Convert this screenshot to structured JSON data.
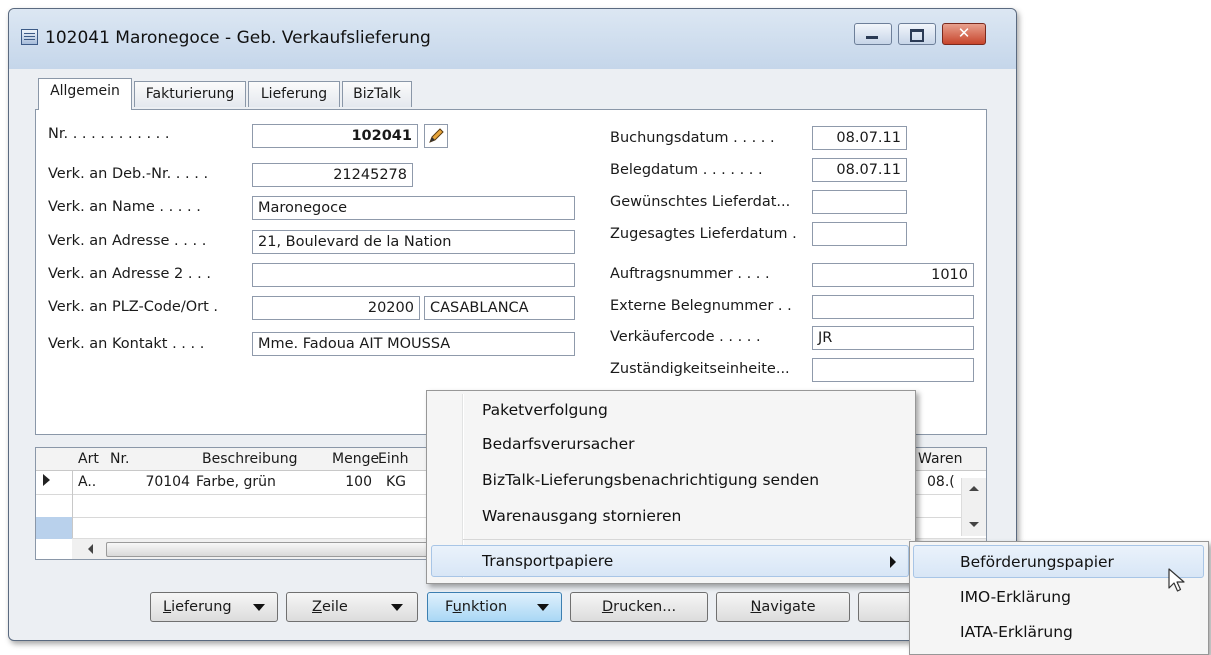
{
  "window": {
    "title": "102041 Maronegoce - Geb. Verkaufslieferung",
    "close_glyph": "✕"
  },
  "tabs": [
    "Allgemein",
    "Fakturierung",
    "Lieferung",
    "BizTalk"
  ],
  "left_fields": [
    {
      "label": "Nr. . . . . . . . . . . .",
      "value": "102041"
    },
    {
      "label": "Verk. an Deb.-Nr. . . . .",
      "value": "21245278"
    },
    {
      "label": "Verk. an Name . . . . .",
      "value": "Maronegoce"
    },
    {
      "label": "Verk. an Adresse . . . .",
      "value": "21, Boulevard de la Nation"
    },
    {
      "label": "Verk. an Adresse 2 . . .",
      "value": ""
    },
    {
      "label": "Verk. an PLZ-Code/Ort .",
      "value": "20200",
      "value2": "CASABLANCA"
    },
    {
      "label": "Verk. an Kontakt . . . .",
      "value": "Mme. Fadoua AIT MOUSSA"
    }
  ],
  "right_fields": [
    {
      "label": "Buchungsdatum . . . . .",
      "value": "08.07.11"
    },
    {
      "label": "Belegdatum . . . . . . .",
      "value": "08.07.11"
    },
    {
      "label": "Gewünschtes Lieferdat...",
      "value": ""
    },
    {
      "label": "Zugesagtes Lieferdatum .",
      "value": ""
    },
    {
      "label": "Auftragsnummer . . . .",
      "value": "1010"
    },
    {
      "label": "Externe Belegnummer . .",
      "value": ""
    },
    {
      "label": "Verkäufercode . . . . .",
      "value": "JR"
    },
    {
      "label": "Zuständigkeitseinheite...",
      "value": ""
    }
  ],
  "lines_table": {
    "headers": [
      "Art",
      "Nr.",
      "Beschreibung",
      "Menge",
      "Einh",
      "Waren"
    ],
    "row": {
      "art": "A..",
      "nr": "70104",
      "beschreibung": "Farbe, grün",
      "menge": "100",
      "einh": "KG",
      "waren": "08.("
    }
  },
  "buttons": {
    "lieferung": {
      "accel": "L",
      "rest": "ieferung"
    },
    "zeile": {
      "accel": "Z",
      "rest": "eile"
    },
    "funktion": {
      "pre": "F",
      "accel": "u",
      "rest": "nktion"
    },
    "drucken": {
      "accel": "D",
      "rest": "rucken..."
    },
    "navigate": {
      "accel": "N",
      "rest": "avigate"
    }
  },
  "function_menu": {
    "items": [
      "Paketverfolgung",
      "Bedarfsverursacher",
      "BizTalk-Lieferungsbenachrichtigung senden",
      "Warenausgang stornieren"
    ],
    "submenu_item": "Transportpapiere"
  },
  "submenu": {
    "items": [
      "Beförderungspapier",
      "IMO-Erklärung",
      "IATA-Erklärung"
    ],
    "highlighted": "Beförderungspapier"
  },
  "colors": {
    "highlight": "#d8e6f6",
    "title_bar": "#c5d6ea",
    "close_button": "#c7452c"
  }
}
